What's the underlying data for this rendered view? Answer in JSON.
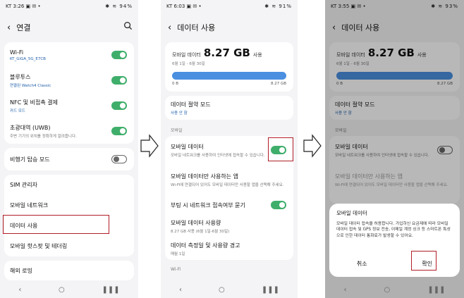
{
  "screen1": {
    "status_time": "KT 3:26",
    "status_icons": "▣ ✉ •",
    "status_right": "✱ ≋ 94%",
    "title": "연결",
    "items": [
      {
        "title": "Wi-Fi",
        "sub": "KT_GiGA_5G_E7CB",
        "toggle": "on"
      },
      {
        "title": "블루투스",
        "sub": "연결된 Watch4 Classic",
        "toggle": "on"
      },
      {
        "title": "NFC 및 비접촉 결제",
        "sub": "카드 모드",
        "toggle": "on"
      },
      {
        "title": "초광대역 (UWB)",
        "sub": "주변 기기의 위치를 정확하게 알려줍니다.",
        "toggle": "on"
      },
      {
        "title": "비행기 탑승 모드",
        "toggle": "off"
      },
      {
        "title": "SIM 관리자"
      },
      {
        "title": "모바일 네트워크"
      },
      {
        "title": "데이터 사용"
      },
      {
        "title": "모바일 핫스팟 및 테더링"
      },
      {
        "title": "해외 로밍"
      }
    ]
  },
  "screen2": {
    "status_time": "KT 6:03",
    "status_icons": "▣ ✉ •",
    "status_right": "✱ ≋ 91%",
    "title": "데이터 사용",
    "usage_prefix": "모바일 데이터",
    "usage_amount": "8.27 GB",
    "usage_suffix": "사용",
    "period": "6월 1일 - 6월 30일",
    "bar_left": "0 B",
    "bar_right": "8.27 GB",
    "saver_title": "데이터 절약 모드",
    "saver_sub": "사용 안 함",
    "section_mobile": "모바일",
    "mobile_data_title": "모바일 데이터",
    "mobile_data_sub": "모바일 네트워크를 사용하여 인터넷에 접속할 수 있습니다.",
    "mobile_only_title": "모바일 데이터만 사용하는 앱",
    "mobile_only_sub": "Wi-Fi에 연결되어 있어도 모바일 데이터만 사용할 앱을 선택해 주세요.",
    "boot_title": "부팅 시 네트워크 접속여부 묻기",
    "usage_title": "모바일 데이터 사용량",
    "usage_sub": "8.27 GB 사용 (6월 1일-6월 30일)",
    "cycle_title": "데이터 측정일 및 사용량 경고",
    "cycle_sub": "매월 1일",
    "section_wifi": "Wi-Fi"
  },
  "screen3": {
    "status_time": "KT 3:55",
    "status_icons": "▣ ✉ •",
    "status_right": "✱ ≋ 93%",
    "title": "데이터 사용",
    "usage_prefix": "모바일 데이터",
    "usage_amount": "8.27 GB",
    "usage_suffix": "사용",
    "period": "6월 1일 - 6월 30일",
    "bar_left": "0 B",
    "bar_right": "8.27 GB",
    "saver_title": "데이터 절약 모드",
    "saver_sub": "사용 안 함",
    "section_mobile": "모바일",
    "mobile_data_title": "모바일 데이터",
    "mobile_data_sub": "모바일 네트워크를 사용하여 인터넷에 접속할 수 있습니다.",
    "mobile_only_title": "모바일 데이터만 사용하는 앱",
    "mobile_only_sub": "Wi-Fi에 연결되어 있어도 모바일 데이터만 사용할 앱을 선택해 주세요.",
    "dialog": {
      "title": "모바일 데이터",
      "body": "모바일 데이터 접속을 허용합니다. 가입하신 요금제에 따라 모바일 데이터 접속 및 GPS 정보 전송, 이메일 계정 싱크 등 스마트폰 특성으로 인한 데이터 통화료가 발생할 수 있어요.",
      "cancel": "취소",
      "confirm": "확인"
    }
  },
  "colors": {
    "accent": "#3fae6b",
    "highlight": "#b11e27",
    "bar": "#4a8fe0"
  }
}
